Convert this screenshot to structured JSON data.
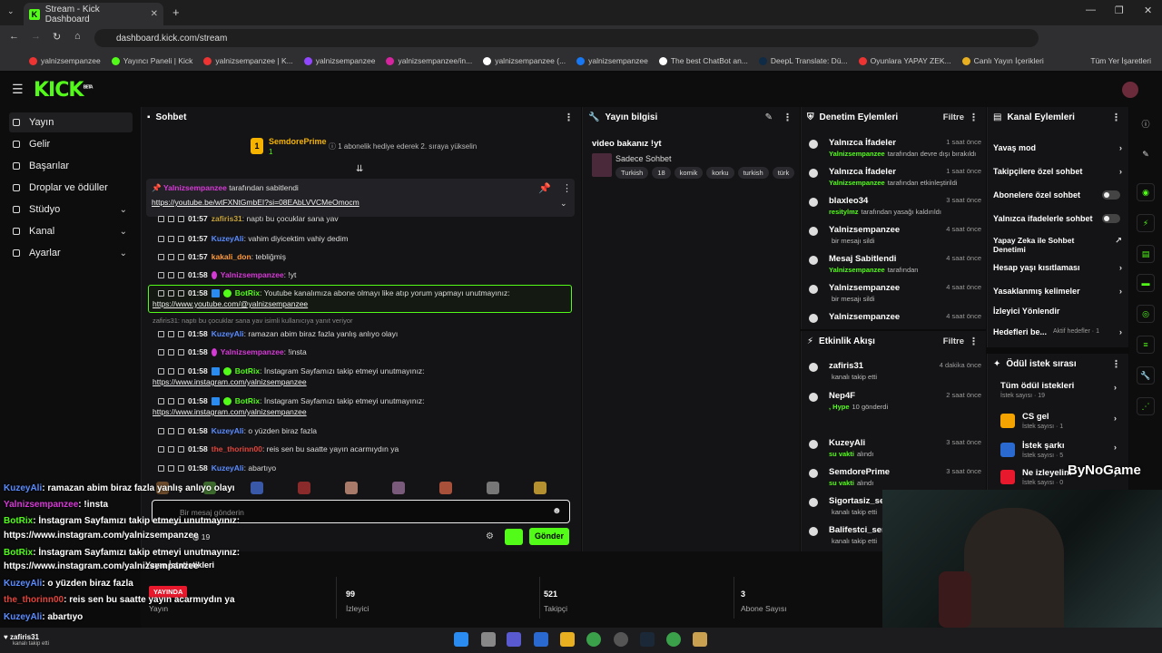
{
  "browser": {
    "tab_title": "Stream - Kick Dashboard",
    "url": "dashboard.kick.com/stream",
    "bookmarks": [
      "yalnizsempanzee",
      "Yayıncı Paneli | Kick",
      "yalnizsempanzee | K...",
      "yalnizsempanzee",
      "yalnizsempanzee/in...",
      "yalnizsempanzee (...",
      "yalnizsempanzee",
      "The best ChatBot an...",
      "DeepL Translate: Dü...",
      "Oyunlara YAPAY ZEK...",
      "Canlı Yayın İçerikleri"
    ],
    "all_bookmarks": "Tüm Yer İşaretleri"
  },
  "header": {
    "logo": "KICK",
    "beta": "BETA"
  },
  "sidebar": {
    "items": [
      {
        "label": "Yayın"
      },
      {
        "label": "Gelir"
      },
      {
        "label": "Başarılar"
      },
      {
        "label": "Droplar ve ödüller"
      },
      {
        "label": "Stüdyo"
      },
      {
        "label": "Kanal"
      },
      {
        "label": "Ayarlar"
      }
    ]
  },
  "chat": {
    "title": "Sohbet",
    "gift": {
      "rank": "1",
      "name": "SemdorePrime",
      "count": "1",
      "text": "1 abonelik hediye ederek 2. sıraya yükselin"
    },
    "pinned": {
      "by": "Yalnizsempanzee",
      "suffix": "tarafından sabitlendi",
      "link": "https://youtube.be/wtFXNtGmbEI?si=08EAbLVVCMeOmocm"
    },
    "messages": [
      {
        "time": "01:57",
        "user": "zafiris31",
        "text": ": naptı bu çocuklar sana yav",
        "color": "#c9a53b"
      },
      {
        "time": "01:57",
        "user": "KuzeyAli",
        "text": ": vahim diyicektim vahiy dedim",
        "color": "#5b8cff"
      },
      {
        "time": "01:57",
        "user": "kakali_don",
        "text": ": tebliğmiş",
        "color": "#ff9a3c"
      },
      {
        "time": "01:58",
        "user": "Yalnizsempanzee",
        "text": ": !yt",
        "color": "#d63ad6"
      },
      {
        "time": "01:58",
        "user": "BotRix",
        "text": ": Youtube kanalımıza abone olmayı like atıp yorum yapmayı unutmayınız:",
        "link": "https://www.youtube.com/@yalnizsempanzee",
        "color": "#53fc18"
      },
      {
        "reply": "zafiris31: naptı bu çocuklar sana yav isimli kullanıcıya yanıt veriyor"
      },
      {
        "time": "01:58",
        "user": "KuzeyAli",
        "text": ": ramazan abim biraz fazla yanlış anlıyo olayı",
        "color": "#5b8cff"
      },
      {
        "time": "01:58",
        "user": "Yalnizsempanzee",
        "text": ": !insta",
        "color": "#d63ad6"
      },
      {
        "time": "01:58",
        "user": "BotRix",
        "text": ": İnstagram Sayfamızı takip etmeyi unutmayınız:",
        "link": "https://www.instagram.com/yalnizsempanzee",
        "color": "#53fc18"
      },
      {
        "time": "01:58",
        "user": "BotRix",
        "text": ": İnstagram Sayfamızı takip etmeyi unutmayınız:",
        "link": "https://www.instagram.com/yalnizsempanzee",
        "color": "#53fc18"
      },
      {
        "time": "01:58",
        "user": "KuzeyAli",
        "text": ": o yüzden biraz fazla",
        "color": "#5b8cff"
      },
      {
        "time": "01:58",
        "user": "the_thorinn00",
        "text": ": reis sen bu saatte yayın acarmıydın ya",
        "color": "#e0453c"
      },
      {
        "time": "01:58",
        "user": "KuzeyAli",
        "text": ": abartıyo",
        "color": "#5b8cff"
      }
    ],
    "placeholder": "Bir mesaj gönderin",
    "points": "19",
    "send": "Gönder"
  },
  "stream_info": {
    "title": "Yayın bilgisi",
    "stream_title": "video bakanız !yt",
    "chat_mode": "Sadece Sohbet",
    "tags": [
      "Turkish",
      "18",
      "komik",
      "korku",
      "turkish",
      "türk"
    ]
  },
  "moderation": {
    "title": "Denetim Eylemleri",
    "filter": "Filtre",
    "items": [
      {
        "title": "Yalnızca İfadeler",
        "who": "Yalnizsempanzee",
        "sub": "tarafından devre dışı bırakıldı",
        "time": "1 saat önce"
      },
      {
        "title": "Yalnızca İfadeler",
        "who": "Yalnizsempanzee",
        "sub": "tarafından etkinleştirildi",
        "time": "1 saat önce"
      },
      {
        "title": "blaxleo34",
        "who": "resitylmz",
        "sub": "tarafından yasağı kaldırıldı",
        "time": "3 saat önce"
      },
      {
        "title": "Yalnizsempanzee",
        "who": "",
        "sub": "bir mesajı sildi",
        "time": "4 saat önce"
      },
      {
        "title": "Mesaj Sabitlendi",
        "who": "Yalnizsempanzee",
        "sub": "tarafından",
        "time": "4 saat önce"
      },
      {
        "title": "Yalnizsempanzee",
        "who": "",
        "sub": "bir mesajı sildi",
        "time": "4 saat önce"
      },
      {
        "title": "Yalnizsempanzee",
        "who": "",
        "sub": "",
        "time": "4 saat önce"
      }
    ]
  },
  "activity": {
    "title": "Etkinlik Akışı",
    "filter": "Filtre",
    "items": [
      {
        "title": "zafiris31",
        "who": "",
        "sub": "kanalı takip etti",
        "time": "4 dakika önce"
      },
      {
        "title": "Nep4F",
        "who": ", Hype",
        "sub": "10 gönderdi",
        "time": "2 saat önce"
      },
      {
        "title": "KuzeyAli",
        "who": "su vakti",
        "sub": "alındı",
        "time": "3 saat önce"
      },
      {
        "title": "SemdorePrime",
        "who": "su vakti",
        "sub": "alındı",
        "time": "3 saat önce"
      },
      {
        "title": "Sigortasiz_sem",
        "who": "",
        "sub": "kanalı takip etti",
        "time": ""
      },
      {
        "title": "Balifestci_semp",
        "who": "",
        "sub": "kanalı takip etti",
        "time": ""
      }
    ]
  },
  "channel_actions": {
    "title": "Kanal Eylemleri",
    "items": [
      {
        "label": "Yavaş mod",
        "kind": "arrow"
      },
      {
        "label": "Takipçilere özel sohbet",
        "kind": "arrow"
      },
      {
        "label": "Abonelere özel sohbet",
        "kind": "toggle"
      },
      {
        "label": "Yalnızca ifadelerle sohbet",
        "kind": "toggle"
      },
      {
        "label": "Yapay Zeka ile Sohbet Denetimi",
        "kind": "ext"
      },
      {
        "label": "Hesap yaşı kısıtlaması",
        "kind": "arrow"
      },
      {
        "label": "Yasaklanmış kelimeler",
        "kind": "arrow"
      },
      {
        "label": "İzleyici Yönlendir",
        "kind": "none"
      },
      {
        "label": "Hedefleri be...",
        "kind": "arrow",
        "extra": "Aktif hedefler · 1"
      }
    ]
  },
  "rewards": {
    "title": "Ödül istek sırası",
    "items": [
      {
        "title": "Tüm ödül istekleri",
        "sub": "İstek sayısı · 19"
      },
      {
        "title": "CS gel",
        "sub": "İstek sayısı · 1"
      },
      {
        "title": "İstek şarkı",
        "sub": "İstek sayısı · 5"
      },
      {
        "title": "Ne izleyelim",
        "sub": "İstek sayısı · 0"
      }
    ]
  },
  "stats": {
    "label": "Yayın İstatistikleri",
    "live": "YAYINDA",
    "stream": "Yayın",
    "viewers": "99",
    "viewers_label": "İzleyici",
    "followers": "521",
    "followers_label": "Takipçi",
    "subs": "3",
    "subs_label": "Abone Sayısı"
  },
  "overlay": {
    "lines": [
      {
        "user": "KuzeyAli",
        "text": ": ramazan abim biraz fazla yanlış anlıyo olayı",
        "color": "#5b8cff"
      },
      {
        "user": "Yalnizsempanzee",
        "text": ": !insta",
        "color": "#d63ad6"
      },
      {
        "user": "BotRix",
        "text": ": İnstagram Sayfamızı takip etmeyi unutmayınız:",
        "color": "#53fc18"
      },
      {
        "user": "",
        "text": "https://www.instagram.com/yalnizsempanzee",
        "color": "#fff"
      },
      {
        "user": "BotRix",
        "text": ": İnstagram Sayfamızı takip etmeyi unutmayınız:",
        "color": "#53fc18"
      },
      {
        "user": "",
        "text": "https://www.instagram.com/yalnizsempanzee",
        "color": "#fff"
      },
      {
        "user": "KuzeyAli",
        "text": ": o yüzden biraz fazla",
        "color": "#5b8cff"
      },
      {
        "user": "the_thorinn00",
        "text": ": reis sen bu saatte yayın acarmıydın ya",
        "color": "#e0453c"
      },
      {
        "user": "KuzeyAli",
        "text": ": abartıyo",
        "color": "#5b8cff"
      }
    ],
    "follow_user": "zafiris31",
    "follow_text": "kanalı takip etti",
    "watermark": "ByNoGame"
  },
  "colors": {
    "accent": "#53fc18",
    "bg": "#0b0b0c",
    "panel": "#141416"
  }
}
